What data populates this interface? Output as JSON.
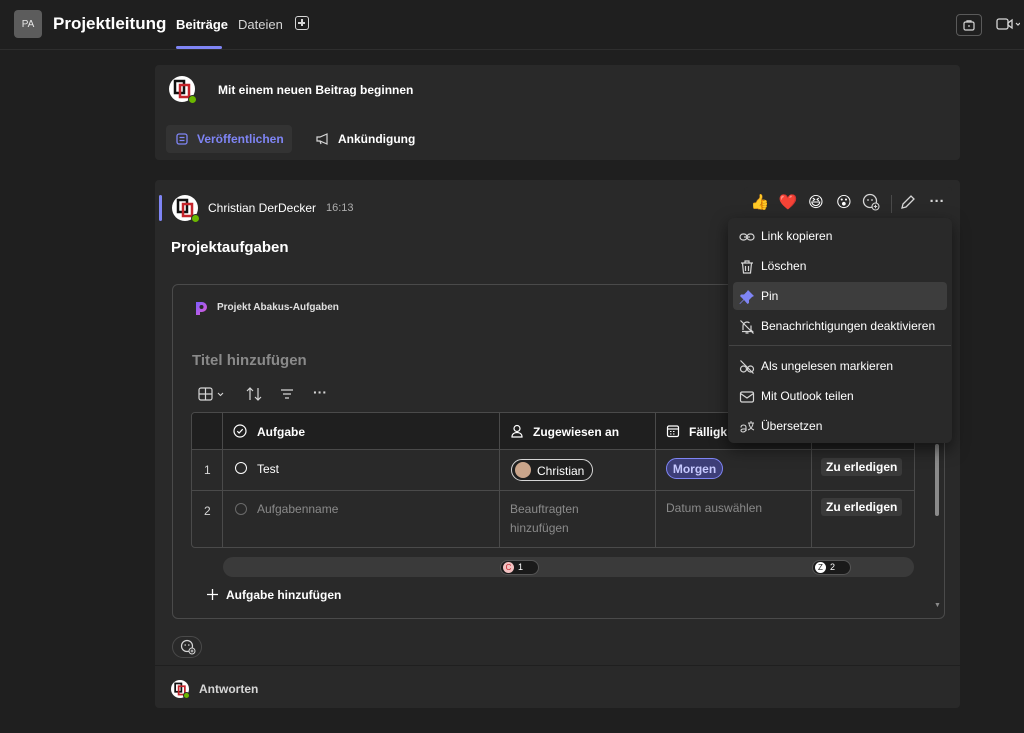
{
  "header": {
    "team_initials": "PA",
    "team_name": "Projektleitung",
    "tabs": [
      {
        "label": "Beiträge",
        "active": true
      },
      {
        "label": "Dateien",
        "active": false
      }
    ],
    "accent": "#7f85f5"
  },
  "compose": {
    "prompt": "Mit einem neuen Beitrag beginnen",
    "publish_label": "Veröffentlichen",
    "announce_label": "Ankündigung"
  },
  "post": {
    "author": "Christian DerDecker",
    "time": "16:13",
    "title": "Projektaufgaben",
    "reactions": [
      "thumbs-up",
      "heart",
      "laugh",
      "surprised",
      "add-reaction"
    ],
    "reply_label": "Antworten"
  },
  "loop": {
    "component_name": "Projekt Abakus-Aufgaben",
    "title_placeholder": "Titel hinzufügen",
    "columns": [
      "Aufgabe",
      "Zugewiesen an",
      "Fälligk"
    ],
    "rows": [
      {
        "num": "1",
        "task": "Test",
        "assignee": "Christian",
        "due": "Morgen",
        "status": "Zu erledigen"
      },
      {
        "num": "2",
        "task": "Aufgabenname",
        "assignee_placeholder": "Beauftragten hinzufügen",
        "due_placeholder": "Datum auswählen",
        "status": "Zu erledigen"
      }
    ],
    "cursors": [
      {
        "initial": "C",
        "count": "1",
        "color": "#f4c2c2"
      },
      {
        "initial": "Z",
        "count": "2",
        "color": "#ffffff"
      }
    ],
    "add_task_label": "Aufgabe hinzufügen"
  },
  "context_menu": {
    "items": [
      {
        "label": "Link kopieren",
        "icon": "link-icon"
      },
      {
        "label": "Löschen",
        "icon": "trash-icon"
      },
      {
        "label": "Pin",
        "icon": "pin-icon",
        "highlighted": true
      },
      {
        "label": "Benachrichtigungen deaktivieren",
        "icon": "bell-off-icon"
      },
      {
        "label": "Als ungelesen markieren",
        "icon": "glasses-icon"
      },
      {
        "label": "Mit Outlook teilen",
        "icon": "mail-icon"
      },
      {
        "label": "Übersetzen",
        "icon": "translate-icon"
      }
    ]
  }
}
